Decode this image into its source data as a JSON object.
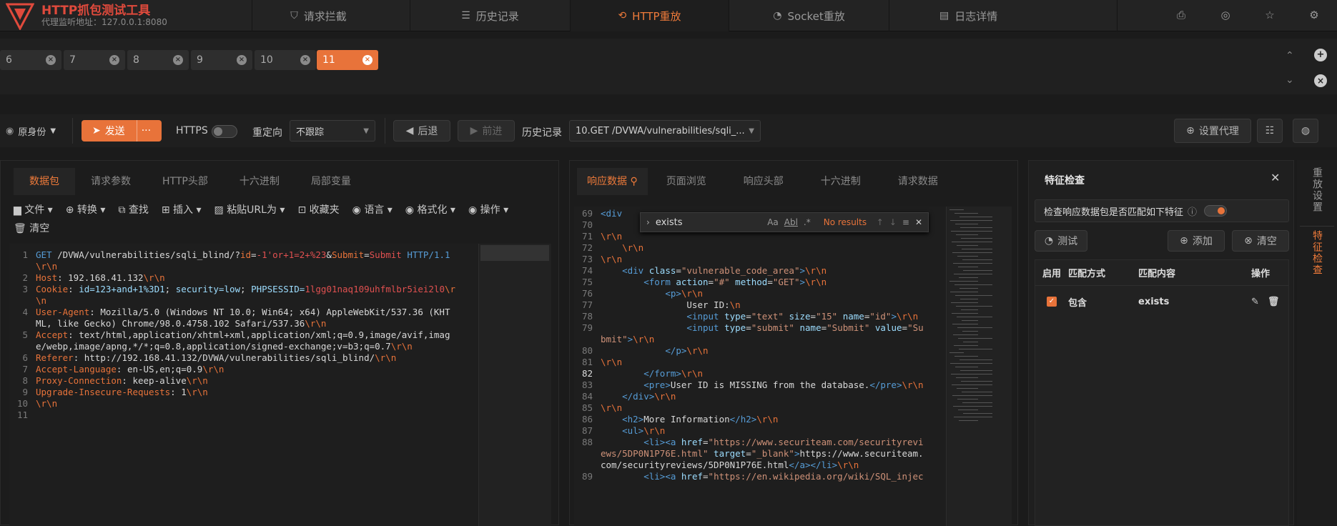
{
  "app": {
    "title": "HTTP抓包测试工具",
    "subtitle": "代理监听地址：127.0.0.1:8080"
  },
  "nav": [
    {
      "label": "请求拦截",
      "icon": "shield-icon"
    },
    {
      "label": "历史记录",
      "icon": "history-icon"
    },
    {
      "label": "HTTP重放",
      "icon": "replay-icon"
    },
    {
      "label": "Socket重放",
      "icon": "socket-icon"
    },
    {
      "label": "日志详情",
      "icon": "log-icon"
    }
  ],
  "replay_tabs": [
    "6",
    "7",
    "8",
    "9",
    "10",
    "11"
  ],
  "toolbar": {
    "identity": "原身份",
    "send": "发送",
    "more": "···",
    "https": "HTTPS",
    "redirect_label": "重定向",
    "redirect_value": "不跟踪",
    "back": "后退",
    "forward": "前进",
    "history_label": "历史记录",
    "history_value": "10.GET /DVWA/vulnerabilities/sqli_...",
    "proxy": "设置代理"
  },
  "request": {
    "tabs": [
      "数据包",
      "请求参数",
      "HTTP头部",
      "十六进制",
      "局部变量"
    ],
    "tools": [
      "文件",
      "转换",
      "查找",
      "插入",
      "粘贴URL为",
      "收藏夹",
      "语言",
      "格式化",
      "操作",
      "清空"
    ],
    "lines": [
      {
        "n": "1",
        "parts": [
          [
            "k",
            "GET "
          ],
          [
            "t",
            "/DVWA/vulnerabilities/sqli_blind/?"
          ],
          [
            "o",
            "id"
          ],
          [
            "t",
            "="
          ],
          [
            "r",
            "-1'or+1=2+%23"
          ],
          [
            "t",
            "&"
          ],
          [
            "o",
            "Submit"
          ],
          [
            "t",
            "="
          ],
          [
            "r",
            "Submit"
          ],
          [
            "k",
            " HTTP/1.1"
          ]
        ]
      },
      {
        "n": "",
        "parts": [
          [
            "o",
            "\\r\\n"
          ]
        ]
      },
      {
        "n": "2",
        "parts": [
          [
            "o",
            "Host"
          ],
          [
            "t",
            ": 192.168.41.132"
          ],
          [
            "o",
            "\\r\\n"
          ]
        ]
      },
      {
        "n": "3",
        "parts": [
          [
            "o",
            "Cookie"
          ],
          [
            "t",
            ": "
          ],
          [
            "a",
            "id=123+and+1%3D1"
          ],
          [
            "t",
            "; "
          ],
          [
            "a",
            "security=low"
          ],
          [
            "t",
            "; "
          ],
          [
            "a",
            "PHPSESSID="
          ],
          [
            "r",
            "1lgg01naq109uhfmlbr5iei2l0"
          ],
          [
            "o",
            "\\r"
          ]
        ]
      },
      {
        "n": "",
        "parts": [
          [
            "o",
            "\\n"
          ]
        ]
      },
      {
        "n": "4",
        "parts": [
          [
            "o",
            "User-Agent"
          ],
          [
            "t",
            ": Mozilla/5.0 (Windows NT 10.0; Win64; x64) AppleWebKit/537.36 (KHT"
          ]
        ]
      },
      {
        "n": "",
        "parts": [
          [
            "t",
            "ML, like Gecko) Chrome/98.0.4758.102 Safari/537.36"
          ],
          [
            "o",
            "\\r\\n"
          ]
        ]
      },
      {
        "n": "5",
        "parts": [
          [
            "o",
            "Accept"
          ],
          [
            "t",
            ": text/html,application/xhtml+xml,application/xml;q=0.9,image/avif,imag"
          ]
        ]
      },
      {
        "n": "",
        "parts": [
          [
            "t",
            "e/webp,image/apng,*/*;q=0.8,application/signed-exchange;v=b3;q=0.7"
          ],
          [
            "o",
            "\\r\\n"
          ]
        ]
      },
      {
        "n": "6",
        "parts": [
          [
            "o",
            "Referer"
          ],
          [
            "t",
            ": http://192.168.41.132/DVWA/vulnerabilities/sqli_blind/"
          ],
          [
            "o",
            "\\r\\n"
          ]
        ]
      },
      {
        "n": "7",
        "parts": [
          [
            "o",
            "Accept-Language"
          ],
          [
            "t",
            ": en-US,en;q=0.9"
          ],
          [
            "o",
            "\\r\\n"
          ]
        ]
      },
      {
        "n": "8",
        "parts": [
          [
            "o",
            "Proxy-Connection"
          ],
          [
            "t",
            ": keep-alive"
          ],
          [
            "o",
            "\\r\\n"
          ]
        ]
      },
      {
        "n": "9",
        "parts": [
          [
            "o",
            "Upgrade-Insecure-Requests"
          ],
          [
            "t",
            ": 1"
          ],
          [
            "o",
            "\\r\\n"
          ]
        ]
      },
      {
        "n": "10",
        "parts": [
          [
            "o",
            "\\r\\n"
          ]
        ]
      },
      {
        "n": "11",
        "parts": []
      }
    ]
  },
  "response": {
    "tabs": [
      "响应数据",
      "页面浏览",
      "响应头部",
      "十六进制",
      "请求数据"
    ],
    "find": {
      "query": "exists",
      "opts": [
        "Aa",
        "Abl",
        ".*"
      ],
      "status": "No results"
    },
    "lines": [
      {
        "n": "69",
        "parts": [
          [
            "k",
            "<div"
          ]
        ]
      },
      {
        "n": "70",
        "parts": []
      },
      {
        "n": "71",
        "parts": [
          [
            "o",
            "\\r\\n"
          ]
        ]
      },
      {
        "n": "72",
        "parts": [
          [
            "t",
            "    "
          ],
          [
            "o",
            "\\r\\n"
          ]
        ]
      },
      {
        "n": "73",
        "parts": [
          [
            "o",
            "\\r\\n"
          ]
        ]
      },
      {
        "n": "74",
        "parts": [
          [
            "t",
            "    "
          ],
          [
            "k",
            "<div "
          ],
          [
            "a",
            "class"
          ],
          [
            "t",
            "="
          ],
          [
            "s",
            "\"vulnerable_code_area\""
          ],
          [
            "k",
            ">"
          ],
          [
            "o",
            "\\r\\n"
          ]
        ]
      },
      {
        "n": "75",
        "parts": [
          [
            "t",
            "        "
          ],
          [
            "k",
            "<form "
          ],
          [
            "a",
            "action"
          ],
          [
            "t",
            "="
          ],
          [
            "s",
            "\"#\""
          ],
          [
            "t",
            " "
          ],
          [
            "a",
            "method"
          ],
          [
            "t",
            "="
          ],
          [
            "s",
            "\"GET\""
          ],
          [
            "k",
            ">"
          ],
          [
            "o",
            "\\r\\n"
          ]
        ]
      },
      {
        "n": "76",
        "parts": [
          [
            "t",
            "            "
          ],
          [
            "k",
            "<p>"
          ],
          [
            "o",
            "\\r\\n"
          ]
        ]
      },
      {
        "n": "77",
        "parts": [
          [
            "t",
            "                User ID:"
          ],
          [
            "o",
            "\\n"
          ]
        ]
      },
      {
        "n": "78",
        "parts": [
          [
            "t",
            "                "
          ],
          [
            "k",
            "<input "
          ],
          [
            "a",
            "type"
          ],
          [
            "t",
            "="
          ],
          [
            "s",
            "\"text\""
          ],
          [
            "t",
            " "
          ],
          [
            "a",
            "size"
          ],
          [
            "t",
            "="
          ],
          [
            "s",
            "\"15\""
          ],
          [
            "t",
            " "
          ],
          [
            "a",
            "name"
          ],
          [
            "t",
            "="
          ],
          [
            "s",
            "\"id\""
          ],
          [
            "k",
            ">"
          ],
          [
            "o",
            "\\r\\n"
          ]
        ]
      },
      {
        "n": "79",
        "parts": [
          [
            "t",
            "                "
          ],
          [
            "k",
            "<input "
          ],
          [
            "a",
            "type"
          ],
          [
            "t",
            "="
          ],
          [
            "s",
            "\"submit\""
          ],
          [
            "t",
            " "
          ],
          [
            "a",
            "name"
          ],
          [
            "t",
            "="
          ],
          [
            "s",
            "\"Submit\""
          ],
          [
            "t",
            " "
          ],
          [
            "a",
            "value"
          ],
          [
            "t",
            "="
          ],
          [
            "s",
            "\"Su"
          ]
        ]
      },
      {
        "n": "",
        "parts": [
          [
            "s",
            "bmit\""
          ],
          [
            "k",
            ">"
          ],
          [
            "o",
            "\\r\\n"
          ]
        ]
      },
      {
        "n": "80",
        "parts": [
          [
            "t",
            "            "
          ],
          [
            "k",
            "</p>"
          ],
          [
            "o",
            "\\r\\n"
          ]
        ]
      },
      {
        "n": "81",
        "parts": [
          [
            "o",
            "\\r\\n"
          ]
        ]
      },
      {
        "n": "82",
        "parts": [
          [
            "t",
            "        "
          ],
          [
            "k",
            "</form>"
          ],
          [
            "o",
            "\\r\\n"
          ]
        ]
      },
      {
        "n": "83",
        "parts": [
          [
            "t",
            "        "
          ],
          [
            "k",
            "<pre>"
          ],
          [
            "t",
            "User ID is MISSING from the database."
          ],
          [
            "k",
            "</pre>"
          ],
          [
            "o",
            "\\r\\n"
          ]
        ]
      },
      {
        "n": "84",
        "parts": [
          [
            "t",
            "    "
          ],
          [
            "k",
            "</div>"
          ],
          [
            "o",
            "\\r\\n"
          ]
        ]
      },
      {
        "n": "85",
        "parts": [
          [
            "o",
            "\\r\\n"
          ]
        ]
      },
      {
        "n": "86",
        "parts": [
          [
            "t",
            "    "
          ],
          [
            "k",
            "<h2>"
          ],
          [
            "t",
            "More Information"
          ],
          [
            "k",
            "</h2>"
          ],
          [
            "o",
            "\\r\\n"
          ]
        ]
      },
      {
        "n": "87",
        "parts": [
          [
            "t",
            "    "
          ],
          [
            "k",
            "<ul>"
          ],
          [
            "o",
            "\\r\\n"
          ]
        ]
      },
      {
        "n": "88",
        "parts": [
          [
            "t",
            "        "
          ],
          [
            "k",
            "<li><a "
          ],
          [
            "a",
            "href"
          ],
          [
            "t",
            "="
          ],
          [
            "s",
            "\"https://www.securiteam.com/securityrevi"
          ]
        ]
      },
      {
        "n": "",
        "parts": [
          [
            "s",
            "ews/5DP0N1P76E.html\""
          ],
          [
            "t",
            " "
          ],
          [
            "a",
            "target"
          ],
          [
            "t",
            "="
          ],
          [
            "s",
            "\"_blank\""
          ],
          [
            "k",
            ">"
          ],
          [
            "t",
            "https://www.securiteam."
          ]
        ]
      },
      {
        "n": "",
        "parts": [
          [
            "t",
            "com/securityreviews/5DP0N1P76E.html"
          ],
          [
            "k",
            "</a></li>"
          ],
          [
            "o",
            "\\r\\n"
          ]
        ]
      },
      {
        "n": "89",
        "parts": [
          [
            "t",
            "        "
          ],
          [
            "k",
            "<li><a "
          ],
          [
            "a",
            "href"
          ],
          [
            "t",
            "="
          ],
          [
            "s",
            "\"https://en.wikipedia.org/wiki/SQL_injec"
          ]
        ]
      }
    ]
  },
  "features": {
    "title": "特征检查",
    "check_label": "检查响应数据包是否匹配如下特征",
    "test": "测试",
    "add": "添加",
    "clear": "清空",
    "columns": [
      "启用",
      "匹配方式",
      "匹配内容",
      "操作"
    ],
    "rows": [
      {
        "mode": "包含",
        "content": "exists"
      }
    ]
  },
  "side": {
    "replay_settings": "重放设置",
    "feature_check": "特征检查"
  },
  "colors": {
    "accent": "#e8733a",
    "brand": "#e04a3c"
  }
}
